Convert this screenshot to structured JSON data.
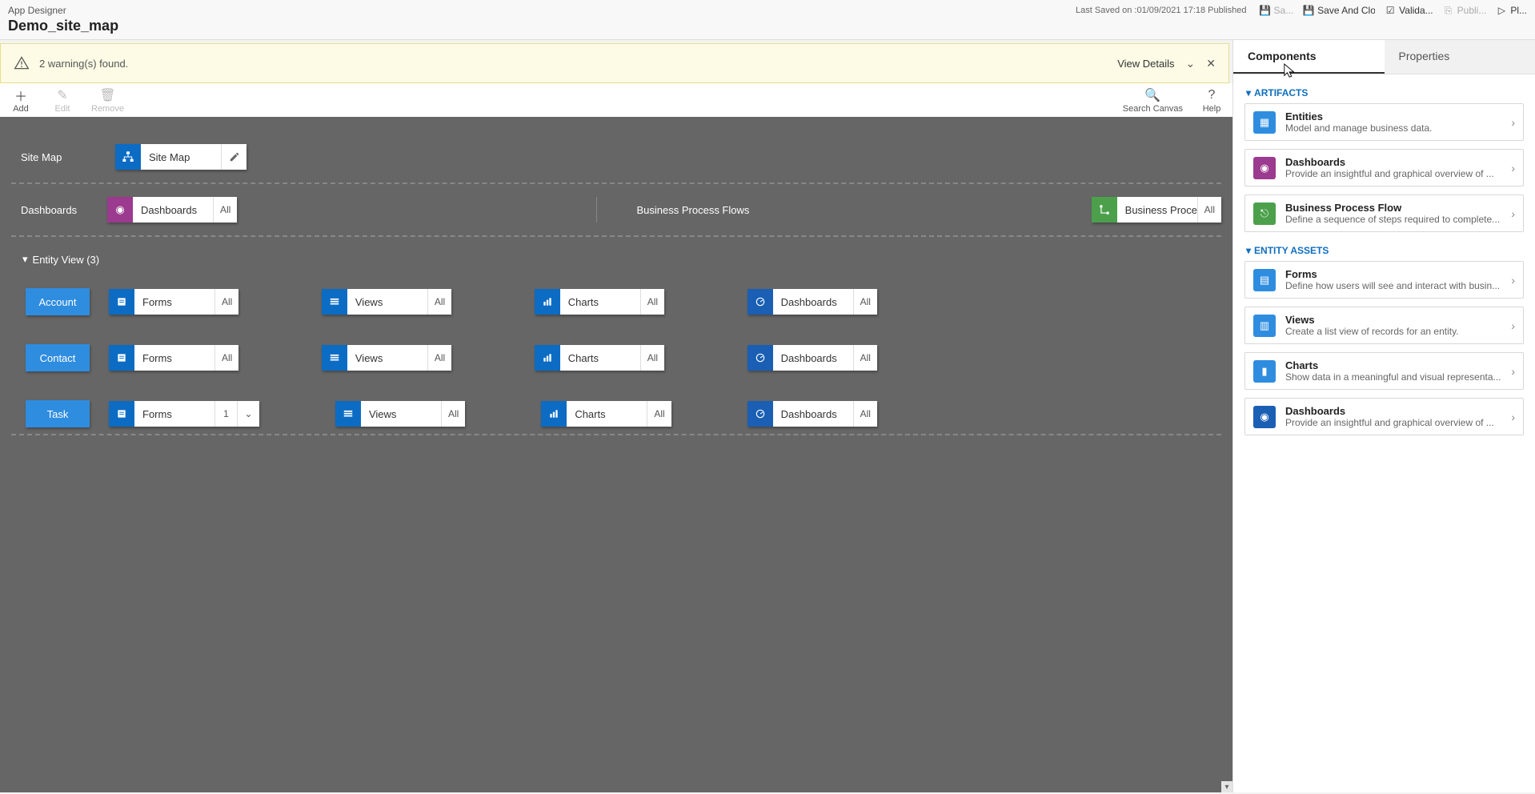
{
  "header": {
    "app_title": "App Designer",
    "page_title": "Demo_site_map",
    "last_saved": "Last Saved on :01/09/2021 17:18 Published",
    "actions": {
      "save": "Sa...",
      "save_close": "Save And Clo...",
      "validate": "Valida...",
      "publish": "Publi...",
      "play": "Pl..."
    }
  },
  "warning": {
    "text": "2 warning(s) found.",
    "view_details": "View Details"
  },
  "toolbar": {
    "add": "Add",
    "edit": "Edit",
    "remove": "Remove",
    "search": "Search Canvas",
    "help": "Help"
  },
  "canvas": {
    "sitemap_label": "Site Map",
    "sitemap_tile": "Site Map",
    "dashboards_label": "Dashboards",
    "dashboards_tile": "Dashboards",
    "bpf_label": "Business Process Flows",
    "bpf_tile": "Business Proces...",
    "all": "All",
    "entity_view_header": "Entity View (3)",
    "entities": [
      {
        "name": "Account",
        "forms_count": "All"
      },
      {
        "name": "Contact",
        "forms_count": "All"
      },
      {
        "name": "Task",
        "forms_count": "1"
      }
    ],
    "asset_labels": {
      "forms": "Forms",
      "views": "Views",
      "charts": "Charts",
      "dashboards": "Dashboards"
    }
  },
  "side": {
    "tab_components": "Components",
    "tab_properties": "Properties",
    "group_artifacts": "ARTIFACTS",
    "group_assets": "ENTITY ASSETS",
    "artifacts": [
      {
        "title": "Entities",
        "desc": "Model and manage business data.",
        "color": "#2f8de0"
      },
      {
        "title": "Dashboards",
        "desc": "Provide an insightful and graphical overview of ...",
        "color": "#9b3a8e"
      },
      {
        "title": "Business Process Flow",
        "desc": "Define a sequence of steps required to complete...",
        "color": "#4ca04c"
      }
    ],
    "assets": [
      {
        "title": "Forms",
        "desc": "Define how users will see and interact with busin...",
        "color": "#2f8de0"
      },
      {
        "title": "Views",
        "desc": "Create a list view of records for an entity.",
        "color": "#2f8de0"
      },
      {
        "title": "Charts",
        "desc": "Show data in a meaningful and visual representa...",
        "color": "#2f8de0"
      },
      {
        "title": "Dashboards",
        "desc": "Provide an insightful and graphical overview of ...",
        "color": "#1a5fb4"
      }
    ]
  }
}
